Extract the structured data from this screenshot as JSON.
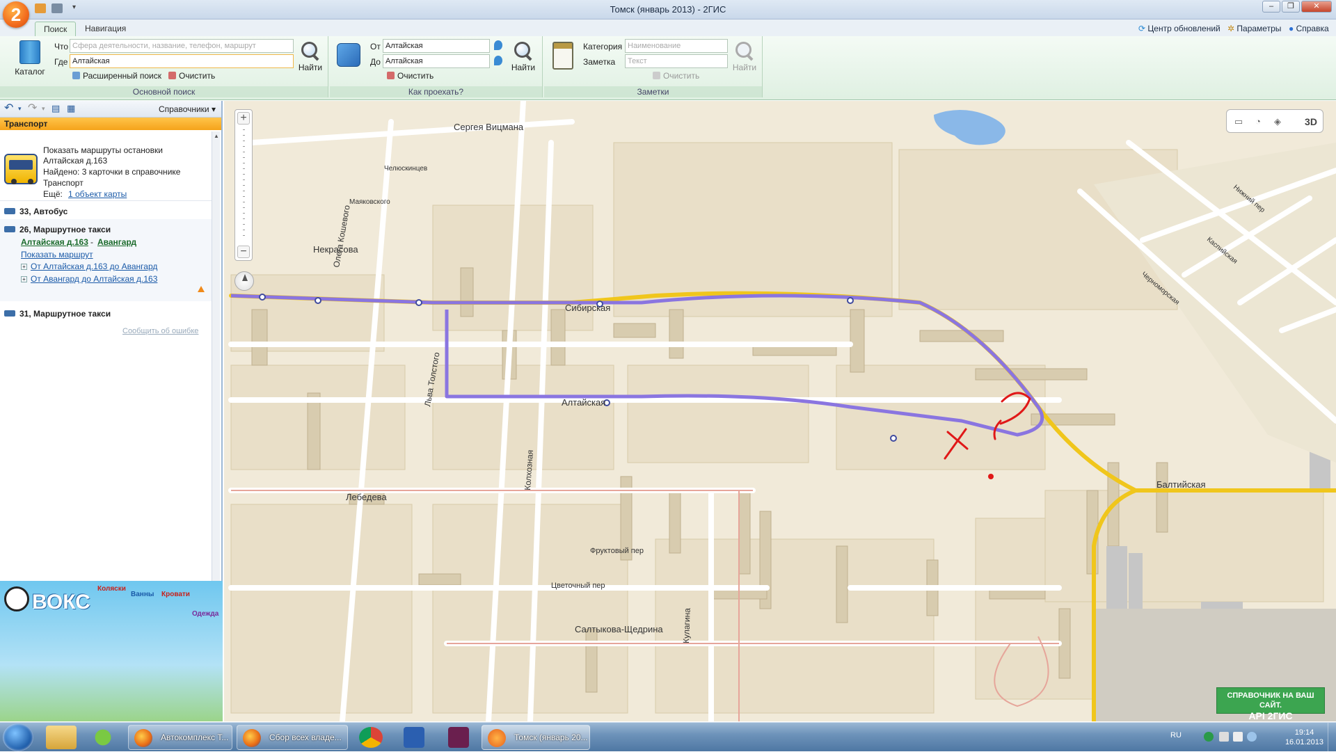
{
  "window": {
    "title": "Томск (январь 2013) - 2ГИС",
    "logo_text": "2"
  },
  "ribbon": {
    "tabs": [
      "Поиск",
      "Навигация"
    ],
    "top_links": {
      "updates": "Центр обновлений",
      "settings": "Параметры",
      "help": "Справка"
    },
    "main_search": {
      "catalog_label": "Каталог",
      "what_label": "Что",
      "what_placeholder": "Сфера деятельности, название, телефон, маршрут",
      "where_label": "Где",
      "where_value": "Алтайская",
      "find_label": "Найти",
      "advanced_label": "Расширенный поиск",
      "clear_label": "Очистить",
      "group_label": "Основной поиск"
    },
    "route": {
      "from_label": "От",
      "from_value": "Алтайская",
      "to_label": "До",
      "to_value": "Алтайская",
      "find_label": "Найти",
      "clear_label": "Очистить",
      "group_label": "Как проехать?"
    },
    "notes": {
      "category_label": "Категория",
      "category_placeholder": "Наименование",
      "note_label": "Заметка",
      "note_placeholder": "Текст",
      "find_label": "Найти",
      "clear_label": "Очистить",
      "group_label": "Заметки"
    }
  },
  "left_panel": {
    "toolbar_dropdown": "Справочники",
    "section_header": "Транспорт",
    "summary": {
      "line1": "Показать маршруты остановки",
      "line2": "Алтайская д.163",
      "line3": "Найдено: 3 карточки в справочнике",
      "line4": "Транспорт",
      "more_label": "Ещё:",
      "more_link": "1 объект карты"
    },
    "routes": [
      {
        "title": "33, Автобус"
      },
      {
        "title": "26, Маршрутное такси",
        "from_link": "Алтайская д.163",
        "separator": "-",
        "to_link": "Авангард",
        "show_route": "Показать маршрут",
        "direction1": "От Алтайская д.163 до Авангард",
        "direction2": "От Авангард до Алтайская д.163"
      },
      {
        "title": "31, Маршрутное такси"
      }
    ],
    "report_error": "Сообщить об ошибке",
    "ad": {
      "brand": "ВОКС",
      "words": [
        "Коляски",
        "Ванны",
        "Кровати",
        "Одежда"
      ]
    }
  },
  "map": {
    "streets": [
      "Сергея Вицмана",
      "Челюскинцев",
      "Маяковского",
      "Некрасова",
      "Олега Кошевого",
      "Сибирская",
      "Алтайская",
      "Льва Толстого",
      "Колхозная",
      "Лебедева",
      "Фруктовый пер",
      "Цветочный пер",
      "Салтыкова-Щедрина",
      "Кулагина",
      "Балтийская",
      "Черноморская",
      "Каспийская",
      "Нижний пер"
    ],
    "view_3d": "3D",
    "api_banner": [
      "СПРАВОЧНИК НА ВАШ САЙТ.",
      "API 2ГИС"
    ]
  },
  "taskbar": {
    "items": [
      {
        "label": "Автокомплекс Т..."
      },
      {
        "label": "Сбор всех владе..."
      },
      {
        "label": "Томск (январь 20..."
      }
    ],
    "lang": "RU",
    "time": "19:14",
    "date": "16.01.2013"
  }
}
